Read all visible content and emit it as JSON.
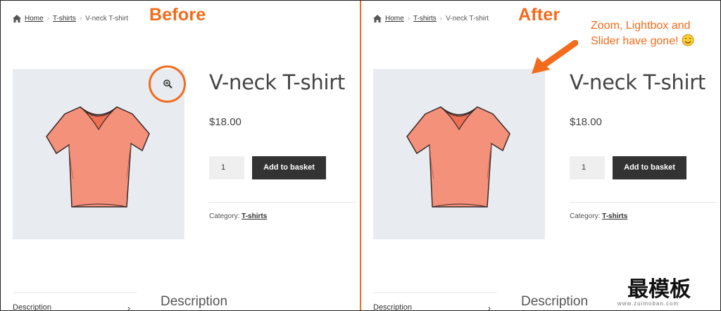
{
  "colors": {
    "accent": "#f36b1c",
    "button_bg": "#333333",
    "image_bg": "#e8ecf1"
  },
  "before_panel": {
    "label": "Before",
    "breadcrumb": {
      "home": "Home",
      "category": "T-shirts",
      "current": "V-neck T-shirt"
    },
    "product": {
      "title": "V-neck T-shirt",
      "price": "$18.00",
      "quantity": "1",
      "add_to_basket": "Add to basket",
      "category_label": "Category:",
      "category_link": "T-shirts"
    },
    "tabs": {
      "description_tab": "Description",
      "description_heading": "Description"
    },
    "icons": {
      "zoom": "zoom-in-icon",
      "home": "home-icon"
    }
  },
  "after_panel": {
    "label": "After",
    "annotation_line1": "Zoom, Lightbox and",
    "annotation_line2": "Slider have gone!",
    "breadcrumb": {
      "home": "Home",
      "category": "T-shirts",
      "current": "V-neck T-shirt"
    },
    "product": {
      "title": "V-neck T-shirt",
      "price": "$18.00",
      "quantity": "1",
      "add_to_basket": "Add to basket",
      "category_label": "Category:",
      "category_link": "T-shirts"
    },
    "tabs": {
      "description_tab": "Description",
      "description_heading": "Description"
    },
    "icons": {
      "home": "home-icon",
      "emoji": "smiling-face-icon",
      "arrow": "arrow-icon"
    }
  },
  "watermark": {
    "text": "最模板",
    "url": "www.zuimoban.com"
  }
}
